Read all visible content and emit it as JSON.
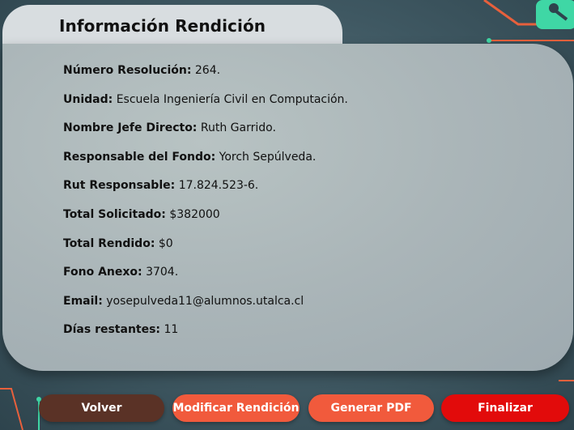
{
  "header": {
    "title": "Información Rendición"
  },
  "details": [
    {
      "label": "Número Resolución:",
      "value": "264."
    },
    {
      "label": "Unidad:",
      "value": "Escuela Ingeniería Civil en Computación."
    },
    {
      "label": "Nombre Jefe Directo:",
      "value": "Ruth Garrido."
    },
    {
      "label": "Responsable del Fondo:",
      "value": "Yorch Sepúlveda."
    },
    {
      "label": "Rut Responsable:",
      "value": "17.824.523-6."
    },
    {
      "label": "Total Solicitado:",
      "value": "$382000"
    },
    {
      "label": "Total Rendido:",
      "value": "$0"
    },
    {
      "label": "Fono Anexo:",
      "value": "3704."
    },
    {
      "label": "Email:",
      "value": "yosepulveda11@alumnos.utalca.cl"
    },
    {
      "label": "Días restantes:",
      "value": "11"
    }
  ],
  "actions": {
    "back": "Volver",
    "edit": "Modificar Rendición",
    "pdf": "Generar PDF",
    "finish": "Finalizar"
  },
  "colors": {
    "back": "#5a3226",
    "edit": "#f15a3c",
    "pdf": "#f15a3c",
    "finish": "#e20b0b",
    "card": "#aab5b8",
    "tab": "#d8dde0",
    "circuit_orange": "#e8603c",
    "circuit_green": "#3fd7a5"
  }
}
